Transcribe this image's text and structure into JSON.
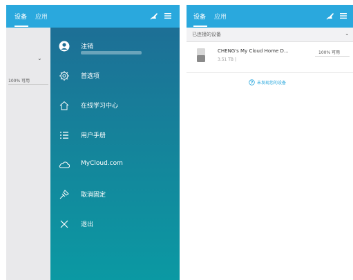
{
  "left_screen": {
    "tabs": [
      "设备",
      "应用"
    ],
    "background_available": "100% 可用",
    "drawer_items": [
      {
        "label": "注销",
        "icon": "user-icon"
      },
      {
        "label": "首选项",
        "icon": "gear-icon"
      },
      {
        "label": "在线学习中心",
        "icon": "home-icon"
      },
      {
        "label": "用户手册",
        "icon": "list-icon"
      },
      {
        "label": "MyCloud.com",
        "icon": "cloud-icon"
      },
      {
        "label": "取消固定",
        "icon": "unpin-icon"
      },
      {
        "label": "退出",
        "icon": "close-icon"
      }
    ]
  },
  "right_screen": {
    "tabs": [
      "设备",
      "应用"
    ],
    "section_label": "已连接的设备",
    "device": {
      "name": "CHENG's My Cloud Home D...",
      "size": "3.51 TB |",
      "available": "100% 可用"
    },
    "not_found_link": "未发现您的设备"
  },
  "colors": {
    "header": "#2aa8dd",
    "drawer_top": "#1d6f96",
    "drawer_bottom": "#0b99a3"
  }
}
